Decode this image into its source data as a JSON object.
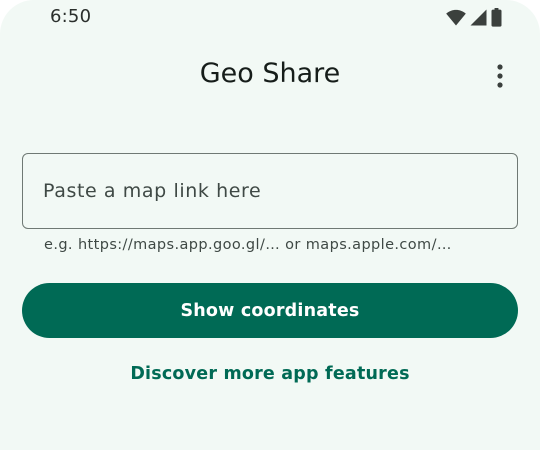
{
  "status_bar": {
    "time": "6:50",
    "icons": [
      "wifi-icon",
      "cellular-signal-icon",
      "battery-icon"
    ]
  },
  "app_bar": {
    "title": "Geo Share",
    "menu_icon": "more-vert-icon"
  },
  "input": {
    "value": "",
    "placeholder": "Paste a map link here",
    "helper_text": "e.g. https://maps.app.goo.gl/… or maps.apple.com/…"
  },
  "actions": {
    "show_coordinates_label": "Show coordinates",
    "discover_features_label": "Discover more app features"
  },
  "colors": {
    "background": "#f2f9f5",
    "primary": "#006a55",
    "on_primary": "#ffffff",
    "outline": "#6f7974",
    "text": "#161d1a",
    "secondary_text": "#3f4945"
  }
}
